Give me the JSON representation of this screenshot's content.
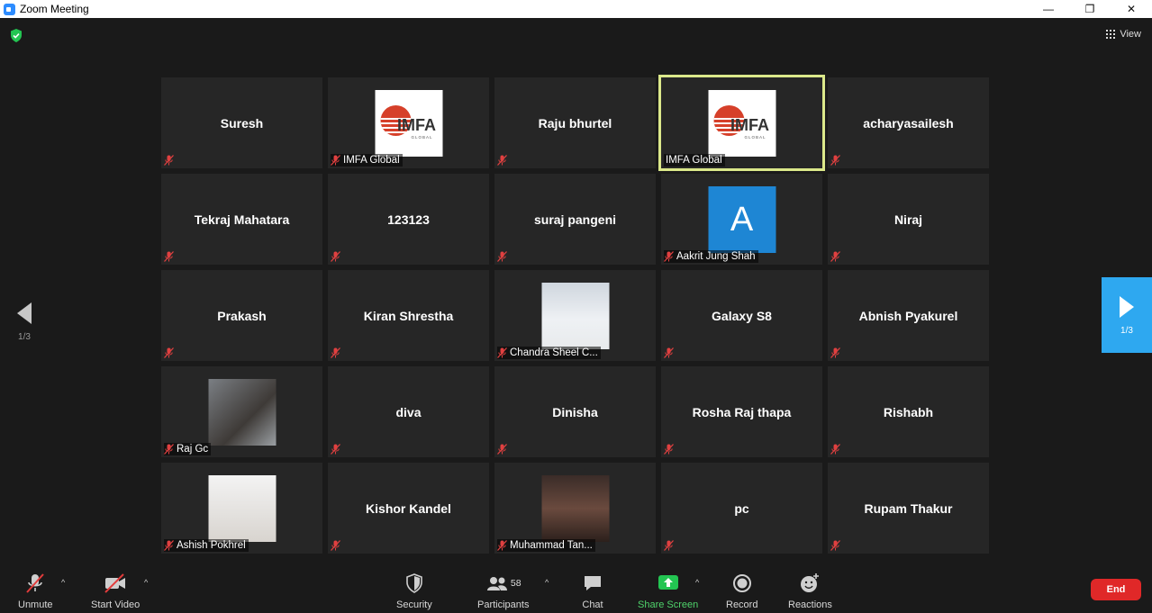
{
  "window": {
    "title": "Zoom Meeting",
    "controls": {
      "minimize": "—",
      "restore": "❐",
      "close": "✕"
    }
  },
  "top": {
    "view_label": "View"
  },
  "nav": {
    "page_left": "1/3",
    "page_right": "1/3"
  },
  "tiles": [
    {
      "name": "Suresh",
      "type": "name"
    },
    {
      "name": "IMFA Global",
      "type": "imfa"
    },
    {
      "name": "Raju bhurtel",
      "type": "name"
    },
    {
      "name": "IMFA Global",
      "type": "imfa",
      "active": true
    },
    {
      "name": "acharyasailesh",
      "type": "name"
    },
    {
      "name": "Tekraj Mahatara",
      "type": "name"
    },
    {
      "name": "123123",
      "type": "name"
    },
    {
      "name": "suraj pangeni",
      "type": "name"
    },
    {
      "name": "Aakrit Jung Shah",
      "type": "avatar",
      "initial": "A"
    },
    {
      "name": "Niraj",
      "type": "name"
    },
    {
      "name": "Prakash",
      "type": "name"
    },
    {
      "name": "Kiran Shrestha",
      "type": "name"
    },
    {
      "name": "Chandra Sheel C...",
      "type": "photo"
    },
    {
      "name": "Galaxy S8",
      "type": "name"
    },
    {
      "name": "Abnish Pyakurel",
      "type": "name"
    },
    {
      "name": "Raj Gc",
      "type": "photo"
    },
    {
      "name": "diva",
      "type": "name"
    },
    {
      "name": "Dinisha",
      "type": "name"
    },
    {
      "name": "Rosha Raj thapa",
      "type": "name"
    },
    {
      "name": "Rishabh",
      "type": "name"
    },
    {
      "name": "Ashish Pokhrel",
      "type": "photo"
    },
    {
      "name": "Kishor Kandel",
      "type": "name"
    },
    {
      "name": "Muhammad Tan...",
      "type": "photo"
    },
    {
      "name": "pc",
      "type": "name"
    },
    {
      "name": "Rupam Thakur",
      "type": "name"
    }
  ],
  "imfa_logo": {
    "text": "IMFA",
    "sub": "GLOBAL"
  },
  "toolbar": {
    "unmute": "Unmute",
    "start_video": "Start Video",
    "security": "Security",
    "participants": "Participants",
    "participants_count": "58",
    "chat": "Chat",
    "share_screen": "Share Screen",
    "record": "Record",
    "reactions": "Reactions",
    "end": "End"
  },
  "colors": {
    "background": "#1a1a1a",
    "tile": "#262626",
    "active_border": "#dbe88a",
    "share_green": "#4fd36b",
    "end_red": "#e02828",
    "nav_blue": "#2ea8f0"
  }
}
